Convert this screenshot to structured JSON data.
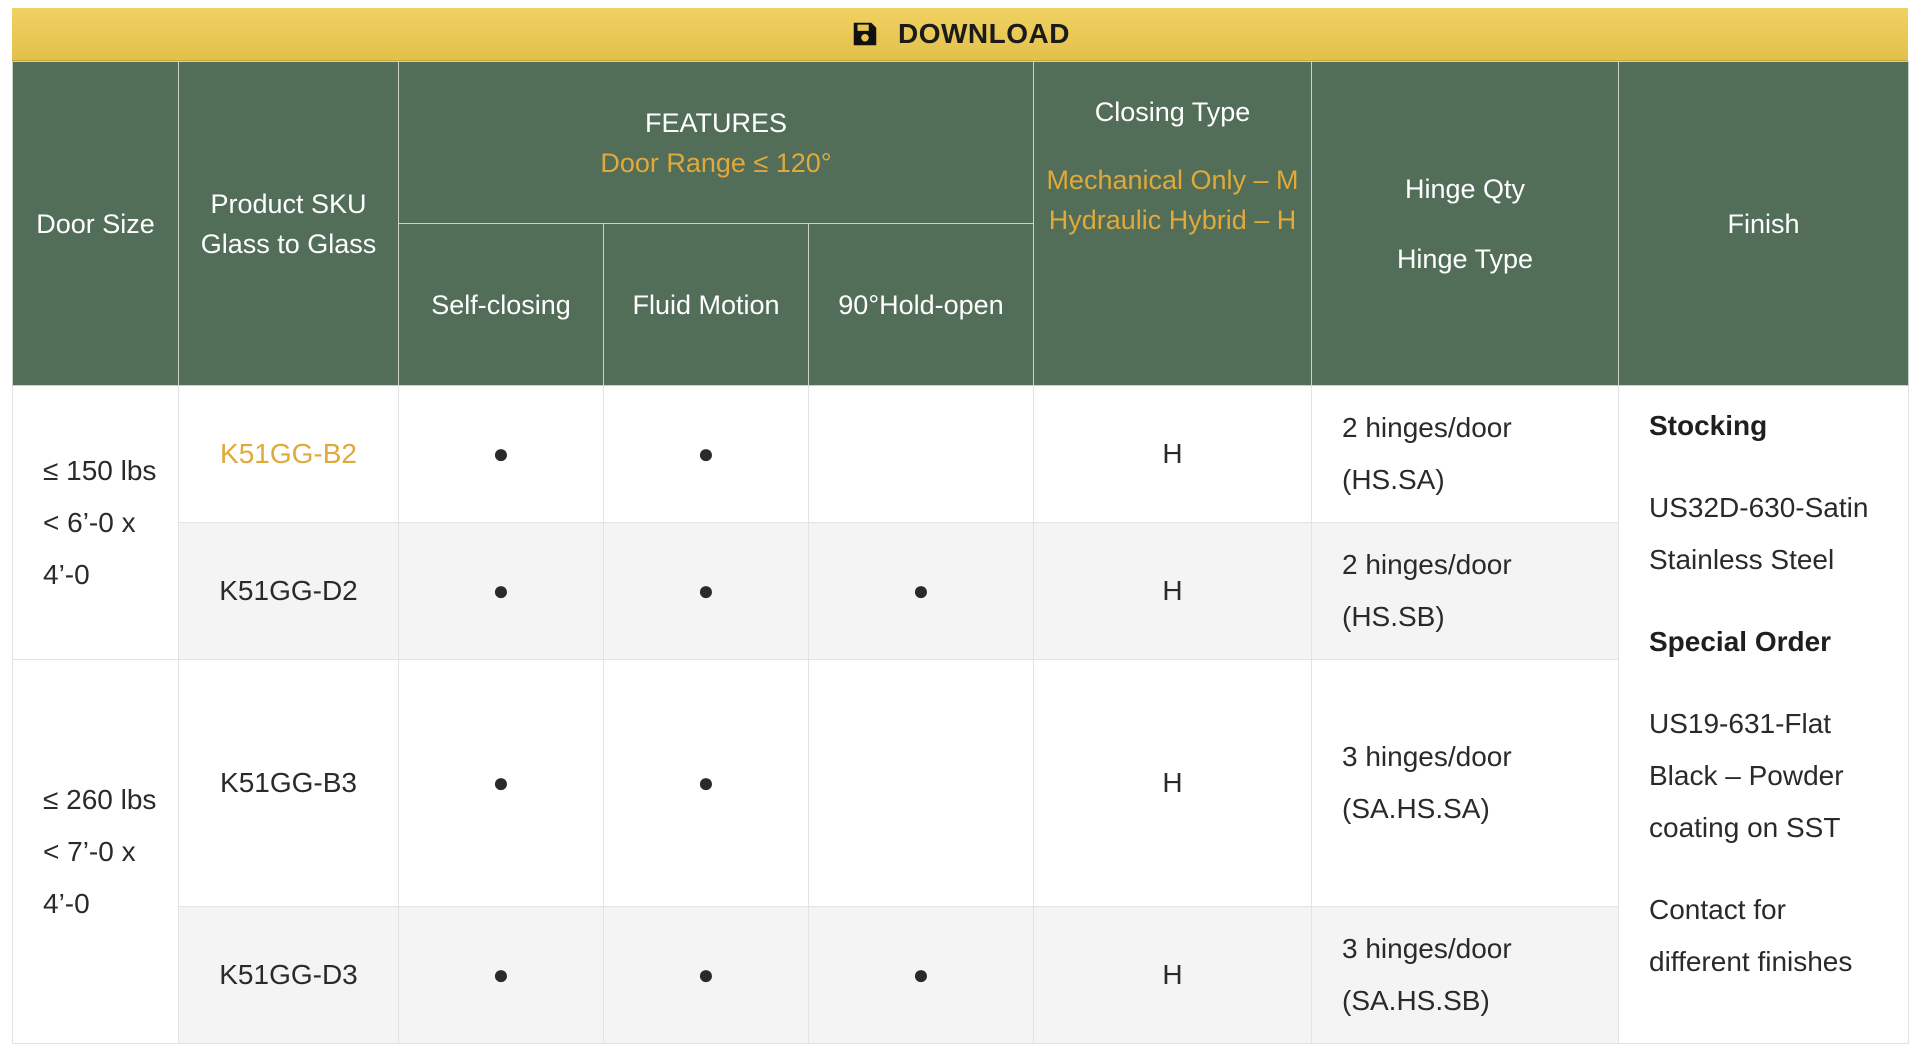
{
  "download": {
    "label": "DOWNLOAD",
    "icon": "floppy-disk-icon"
  },
  "colors": {
    "header_bg": "#526d58",
    "accent": "#e0a93a",
    "download_bg": "#e8c652"
  },
  "headers": {
    "door_size": "Door Size",
    "sku": "Product SKU Glass to Glass",
    "features": "FEATURES",
    "door_range": "Door Range ≤ 120°",
    "self_closing": "Self-closing",
    "fluid_motion": "Fluid Motion",
    "hold_open": "90°Hold-open",
    "closing_type": "Closing Type",
    "closing_mechanical": "Mechanical Only – M",
    "closing_hydraulic": "Hydraulic Hybrid – H",
    "hinge_qty": "Hinge Qty",
    "hinge_type": "Hinge Type",
    "finish": "Finish"
  },
  "groups": [
    {
      "weight": "≤ 150 lbs",
      "size": "< 6’-0 x 4’-0"
    },
    {
      "weight": "≤ 260 lbs",
      "size": "< 7’-0 x 4’-0"
    }
  ],
  "rows": [
    {
      "sku": "K51GG-B2",
      "self_closing": "●",
      "fluid_motion": "●",
      "hold_open": "",
      "closing": "H",
      "hinge_qty": "2 hinges/door",
      "hinge_type": "(HS.SA)"
    },
    {
      "sku": "K51GG-D2",
      "self_closing": "●",
      "fluid_motion": "●",
      "hold_open": "●",
      "closing": "H",
      "hinge_qty": "2 hinges/door",
      "hinge_type": "(HS.SB)"
    },
    {
      "sku": "K51GG-B3",
      "self_closing": "●",
      "fluid_motion": "●",
      "hold_open": "",
      "closing": "H",
      "hinge_qty": "3 hinges/door",
      "hinge_type": "(SA.HS.SA)"
    },
    {
      "sku": "K51GG-D3",
      "self_closing": "●",
      "fluid_motion": "●",
      "hold_open": "●",
      "closing": "H",
      "hinge_qty": "3 hinges/door",
      "hinge_type": "(SA.HS.SB)"
    }
  ],
  "finish": {
    "stocking_label": "Stocking",
    "stocking_value": "US32D-630-Satin Stainless Steel",
    "special_label": "Special Order",
    "special_value": "US19-631-Flat Black – Powder coating on SST",
    "contact": "Contact for different finishes"
  }
}
